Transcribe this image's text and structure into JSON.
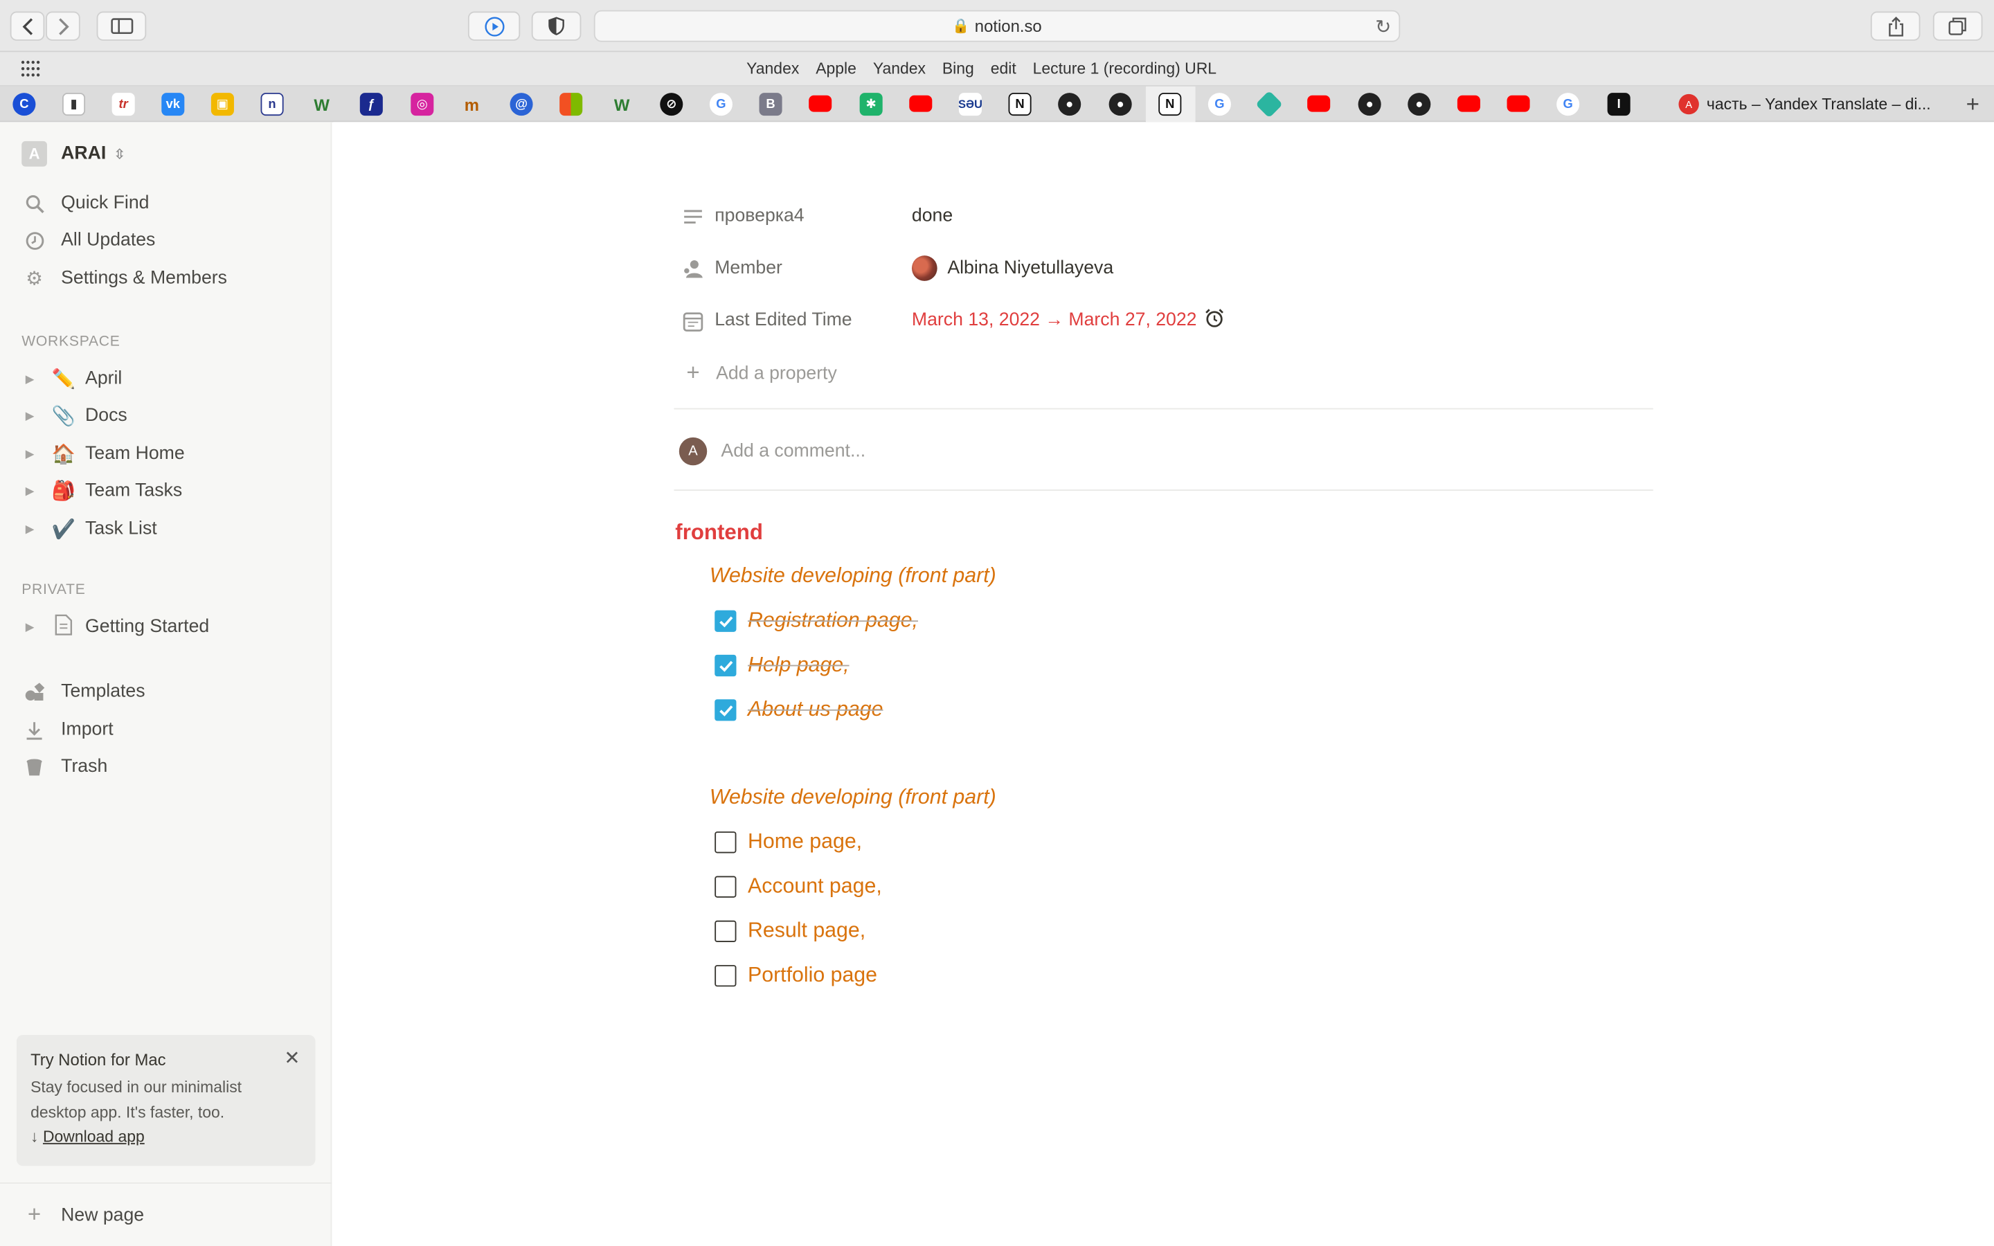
{
  "browser": {
    "url": "notion.so",
    "favorites": [
      "Yandex",
      "Apple",
      "Yandex",
      "Bing",
      "edit",
      "Lecture 1 (recording) URL"
    ],
    "active_tab_title": "часть – Yandex Translate – di..."
  },
  "sidebar": {
    "workspace": {
      "avatar_letter": "A",
      "name": "ARAI"
    },
    "top_items": [
      {
        "label": "Quick Find",
        "icon": "search-icon"
      },
      {
        "label": "All Updates",
        "icon": "clock-icon"
      },
      {
        "label": "Settings & Members",
        "icon": "gear-icon"
      }
    ],
    "workspace_section": "WORKSPACE",
    "workspace_pages": [
      {
        "emoji": "✏️",
        "label": "April"
      },
      {
        "emoji": "📎",
        "label": "Docs"
      },
      {
        "emoji": "🏠",
        "label": "Team Home"
      },
      {
        "emoji": "🎒",
        "label": "Team Tasks"
      },
      {
        "emoji": "✔️",
        "label": "Task List"
      }
    ],
    "private_section": "PRIVATE",
    "private_pages": [
      {
        "emoji": "📄",
        "label": "Getting Started"
      }
    ],
    "bottom_items": [
      {
        "label": "Templates",
        "icon": "templates-icon"
      },
      {
        "label": "Import",
        "icon": "import-icon"
      },
      {
        "label": "Trash",
        "icon": "trash-icon"
      }
    ],
    "promo": {
      "title": "Try Notion for Mac",
      "line1": "Stay focused in our minimalist",
      "line2": "desktop app. It's faster, too.",
      "arrow": "↓",
      "link": "Download app"
    },
    "new_page": "New page"
  },
  "page": {
    "properties": [
      {
        "name": "проверка4",
        "value": "done",
        "icon": "text-lines-icon"
      },
      {
        "name": "Member",
        "value": "Albina Niyetullayeva",
        "icon": "person-icon"
      },
      {
        "name": "Last Edited Time",
        "value": "March 13, 2022 → March 27, 2022",
        "icon": "calendar-icon"
      }
    ],
    "add_property": "Add a property",
    "comment_avatar": "A",
    "comment_placeholder": "Add a comment...",
    "heading": "frontend",
    "groups": [
      {
        "title": "Website developing (front part)",
        "todos": [
          {
            "text": "Registration page,",
            "checked": true
          },
          {
            "text": "Help page,",
            "checked": true
          },
          {
            "text": "About us page",
            "checked": true
          }
        ]
      },
      {
        "title": "Website developing (front part)",
        "todos": [
          {
            "text": "Home page,",
            "checked": false
          },
          {
            "text": "Account page,",
            "checked": false
          },
          {
            "text": "Result page,",
            "checked": false
          },
          {
            "text": "Portfolio page",
            "checked": false
          }
        ]
      }
    ]
  },
  "colors": {
    "red": "#e03e3e",
    "orange": "#d9730d",
    "checkbox_blue": "#2eaadc"
  }
}
